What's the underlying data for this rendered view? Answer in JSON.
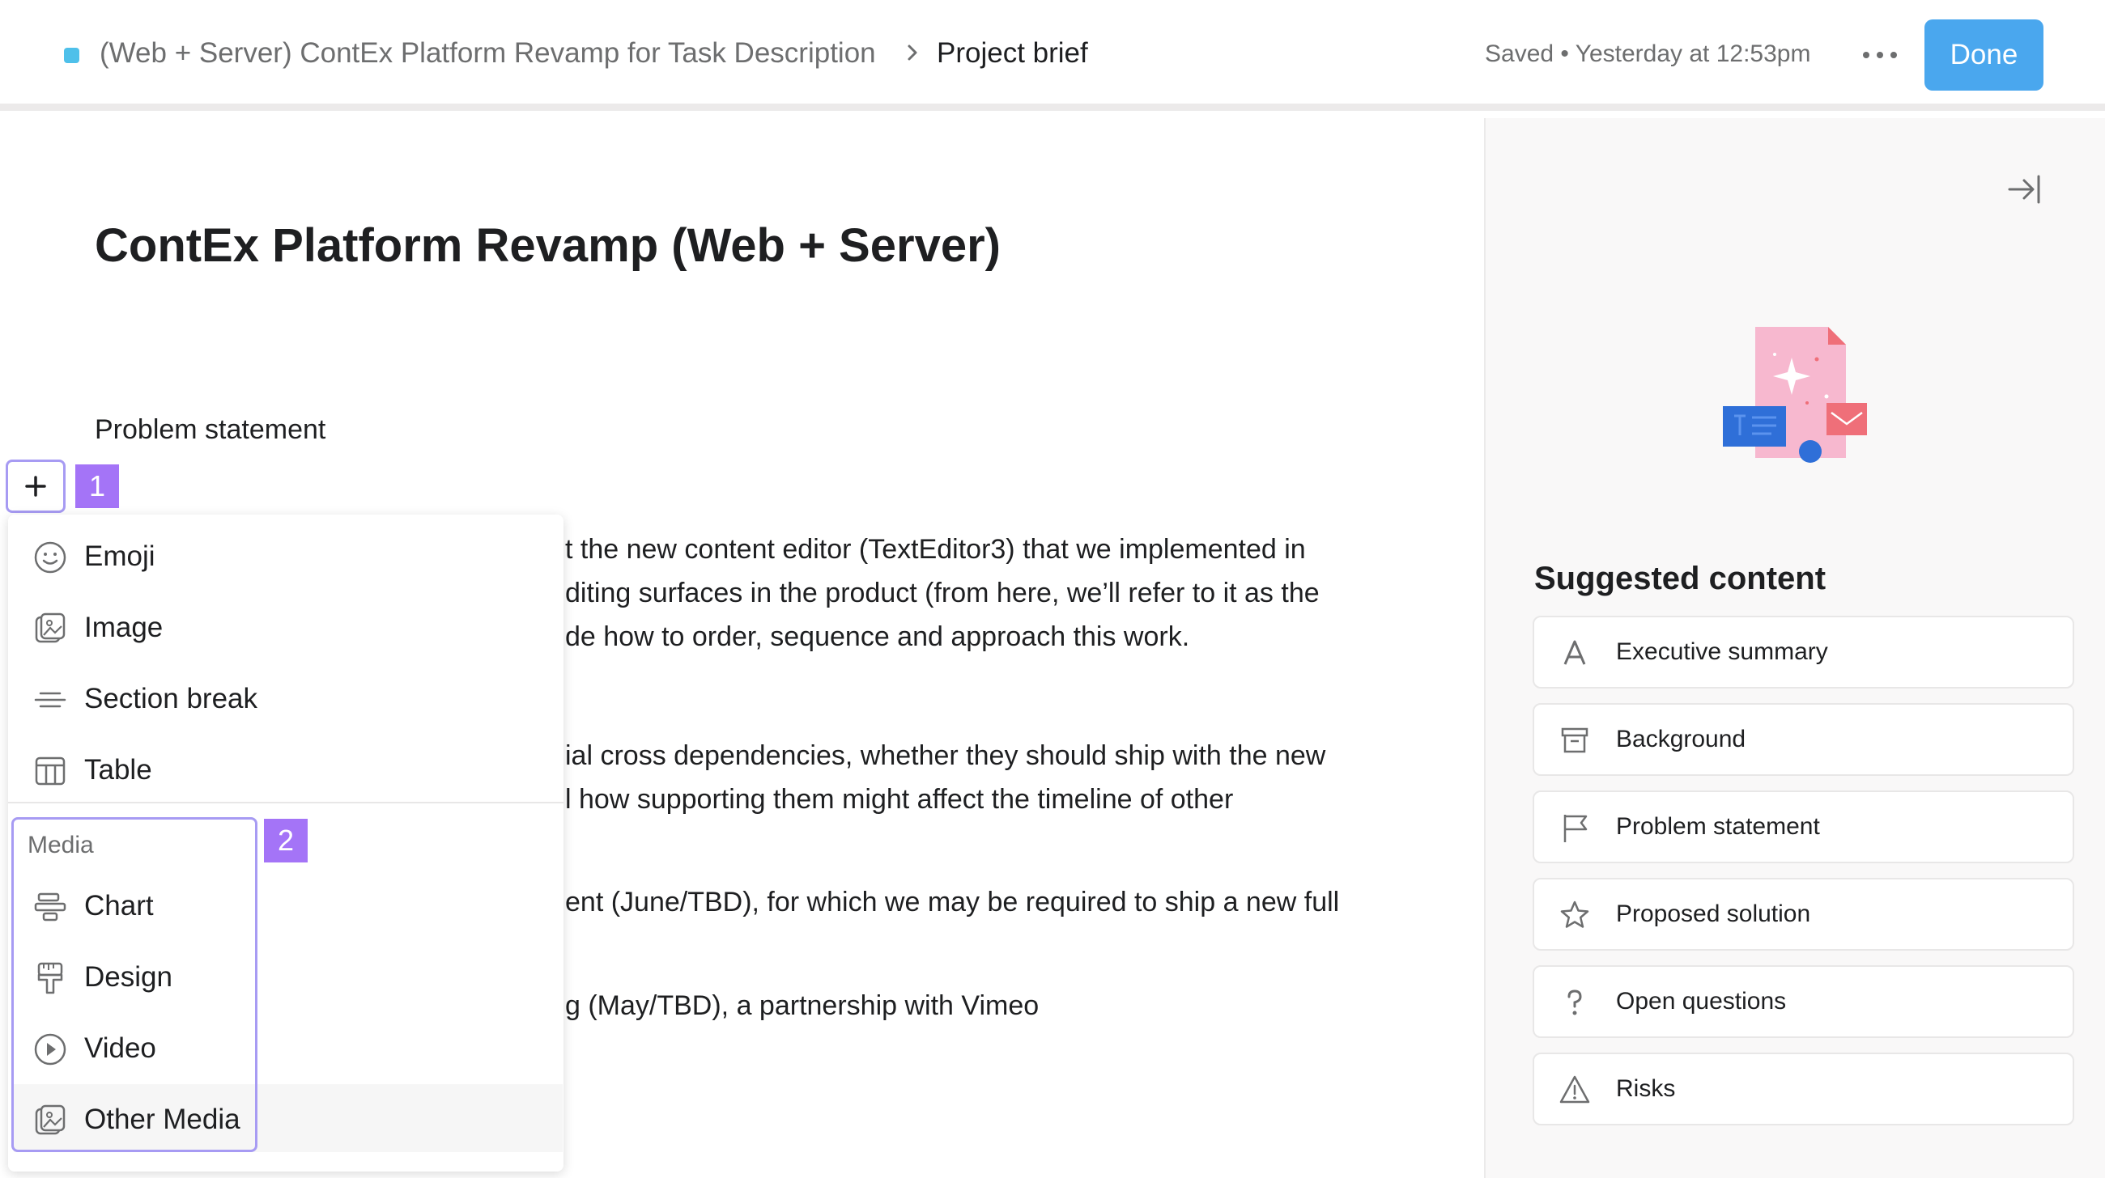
{
  "header": {
    "project_name": "(Web + Server) ContEx Platform Revamp for Task Description",
    "current_page": "Project brief",
    "saved_status": "Saved • Yesterday at 12:53pm",
    "done_label": "Done",
    "project_color": "#4ec0ea"
  },
  "document": {
    "title": "ContEx Platform Revamp (Web + Server)",
    "section_label": "Problem statement",
    "visible_lines": [
      "t the new content editor (TextEditor3) that we implemented in",
      "diting surfaces in the product (from here, we’ll refer to it as the",
      "de how to order, sequence and approach this work.",
      "ial cross dependencies, whether they should ship with the new",
      "l how supporting them might affect the timeline of other",
      "ent (June/TBD), for which we may be required to ship a new full",
      "g (May/TBD), a partnership with Vimeo"
    ]
  },
  "insert_menu": {
    "badge_1": "1",
    "badge_2": "2",
    "items": [
      {
        "label": "Emoji",
        "icon": "emoji-icon"
      },
      {
        "label": "Image",
        "icon": "image-icon"
      },
      {
        "label": "Section break",
        "icon": "section-break-icon"
      },
      {
        "label": "Table",
        "icon": "table-icon"
      }
    ],
    "media_heading": "Media",
    "media_items": [
      {
        "label": "Chart",
        "icon": "chart-icon"
      },
      {
        "label": "Design",
        "icon": "design-icon"
      },
      {
        "label": "Video",
        "icon": "video-icon"
      },
      {
        "label": "Other Media",
        "icon": "other-media-icon"
      }
    ],
    "highlight_color": "#a474f7"
  },
  "right_panel": {
    "title": "Suggested content",
    "items": [
      {
        "label": "Executive summary",
        "icon": "text-a-icon"
      },
      {
        "label": "Background",
        "icon": "archive-icon"
      },
      {
        "label": "Problem statement",
        "icon": "flag-icon"
      },
      {
        "label": "Proposed solution",
        "icon": "star-icon"
      },
      {
        "label": "Open questions",
        "icon": "question-icon"
      },
      {
        "label": "Risks",
        "icon": "warning-icon"
      }
    ]
  }
}
